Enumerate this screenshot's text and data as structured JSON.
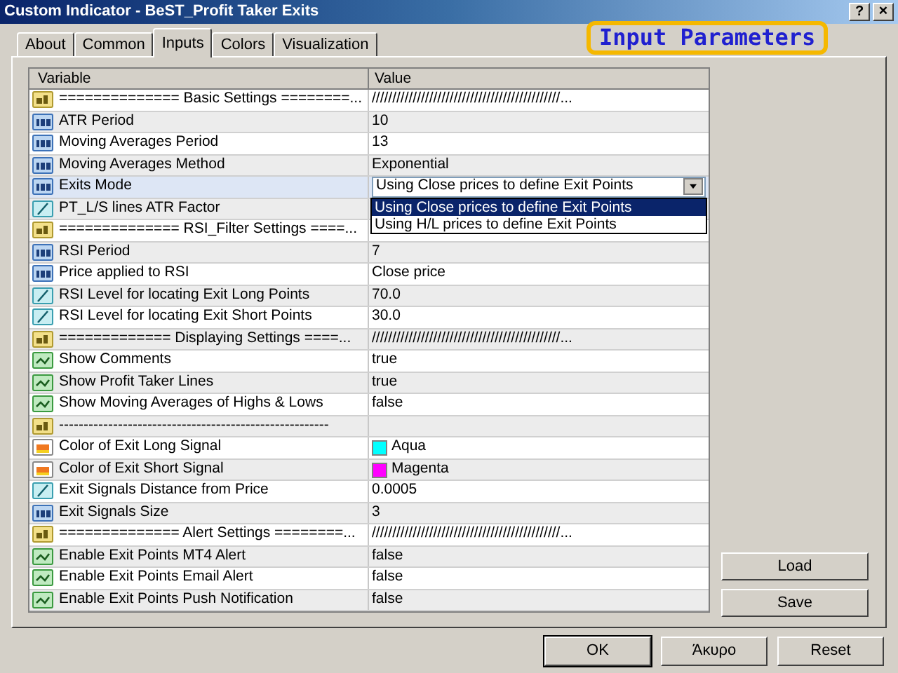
{
  "window": {
    "title": "Custom Indicator - BeST_Profit Taker Exits",
    "help": "?",
    "close": "×"
  },
  "annotation": "Input Parameters",
  "tabs": [
    {
      "label": "About",
      "selected": false
    },
    {
      "label": "Common",
      "selected": false
    },
    {
      "label": "Inputs",
      "selected": true
    },
    {
      "label": "Colors",
      "selected": false
    },
    {
      "label": "Visualization",
      "selected": false
    }
  ],
  "table": {
    "columns": [
      "Variable",
      "Value"
    ],
    "rows": [
      {
        "kind": "string",
        "name": "============== Basic Settings ========...",
        "value": "//////////////////////////////////////////////...",
        "selected": false
      },
      {
        "kind": "integer",
        "name": "ATR Period",
        "value": "10",
        "selected": false
      },
      {
        "kind": "integer",
        "name": "Moving Averages Period",
        "value": "13",
        "selected": false
      },
      {
        "kind": "integer",
        "name": "Moving Averages Method",
        "value": "Exponential",
        "selected": false
      },
      {
        "kind": "integer",
        "name": "Exits Mode",
        "value": "Using Close prices to define Exit Points",
        "selected": true,
        "dropdown": {
          "options": [
            {
              "label": "Using Close prices to define Exit Points",
              "selected": true
            },
            {
              "label": "Using H/L prices to define Exit Points",
              "selected": false
            }
          ]
        }
      },
      {
        "kind": "double",
        "name": "PT_L/S lines ATR Factor",
        "selected": false
      },
      {
        "kind": "string",
        "name": "============== RSI_Filter Settings ====...",
        "selected": false
      },
      {
        "kind": "integer",
        "name": "RSI Period",
        "value": "7",
        "selected": false
      },
      {
        "kind": "integer",
        "name": "Price applied to RSI",
        "value": "Close price",
        "selected": false
      },
      {
        "kind": "double",
        "name": "RSI Level for locating Exit Long Points",
        "value": "70.0",
        "selected": false
      },
      {
        "kind": "double",
        "name": "RSI Level for locating Exit Short Points",
        "value": "30.0",
        "selected": false
      },
      {
        "kind": "string",
        "name": "=============  Displaying Settings  ====...",
        "value": "//////////////////////////////////////////////...",
        "selected": false
      },
      {
        "kind": "bool",
        "name": "Show Comments",
        "value": "true",
        "selected": false
      },
      {
        "kind": "bool",
        "name": "Show Profit Taker Lines",
        "value": "true",
        "selected": false
      },
      {
        "kind": "bool",
        "name": "Show Moving Averages of Highs & Lows",
        "value": "false",
        "selected": false
      },
      {
        "kind": "string",
        "name": "-------------------------------------------------------",
        "selected": false
      },
      {
        "kind": "color",
        "name": "Color of Exit Long Signal",
        "value": "Aqua",
        "color": "#00ffff",
        "selected": false
      },
      {
        "kind": "color",
        "name": "Color of Exit Short Signal",
        "value": "Magenta",
        "color": "#ff00ff",
        "selected": false
      },
      {
        "kind": "double",
        "name": "Exit Signals Distance from Price",
        "value": "0.0005",
        "selected": false
      },
      {
        "kind": "integer",
        "name": "Exit Signals Size",
        "value": "3",
        "selected": false
      },
      {
        "kind": "string",
        "name": "============== Alert Settings ========...",
        "value": "//////////////////////////////////////////////...",
        "selected": false
      },
      {
        "kind": "bool",
        "name": "Enable Exit Points  MT4 Alert",
        "value": "false",
        "selected": false
      },
      {
        "kind": "bool",
        "name": "Enable Exit Points  Email Alert",
        "value": "false",
        "selected": false
      },
      {
        "kind": "bool",
        "name": "Enable Exit Points  Push Notification",
        "value": "false",
        "selected": false
      }
    ]
  },
  "side_buttons": [
    "Load",
    "Save"
  ],
  "buttons": [
    {
      "label": "OK",
      "default": true
    },
    {
      "label": "Άκυρο",
      "default": false
    },
    {
      "label": "Reset",
      "default": false
    }
  ]
}
